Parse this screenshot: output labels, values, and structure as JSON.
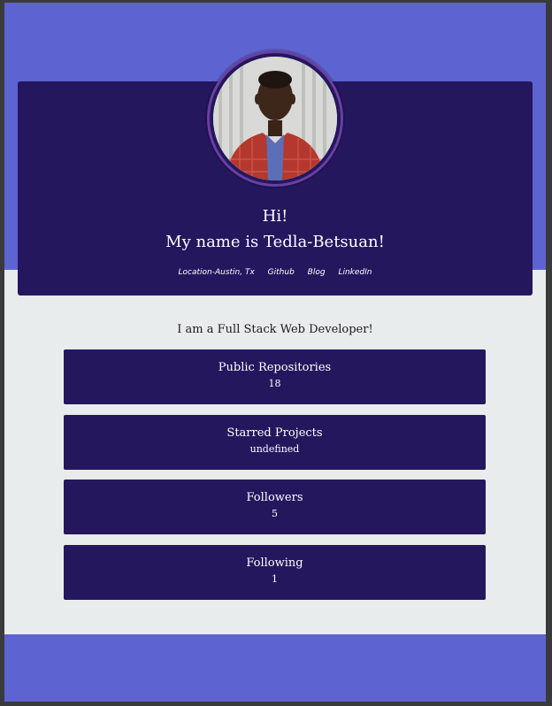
{
  "colors": {
    "band": "#5d64d1",
    "card": "#24175e",
    "background": "#e9ecec",
    "avatar_ring": "#6a3fa0"
  },
  "profile": {
    "greeting": "Hi!",
    "name_line": "My name is Tedla-Betsuan!",
    "avatar_icon": "profile-photo"
  },
  "links": [
    {
      "label": "Location-Austin, Tx"
    },
    {
      "label": "Github"
    },
    {
      "label": "Blog"
    },
    {
      "label": "LinkedIn"
    }
  ],
  "tagline": "I am a Full Stack Web Developer!",
  "stats": [
    {
      "title": "Public Repositories",
      "value": "18"
    },
    {
      "title": "Starred Projects",
      "value": "undefined"
    },
    {
      "title": "Followers",
      "value": "5"
    },
    {
      "title": "Following",
      "value": "1"
    }
  ]
}
